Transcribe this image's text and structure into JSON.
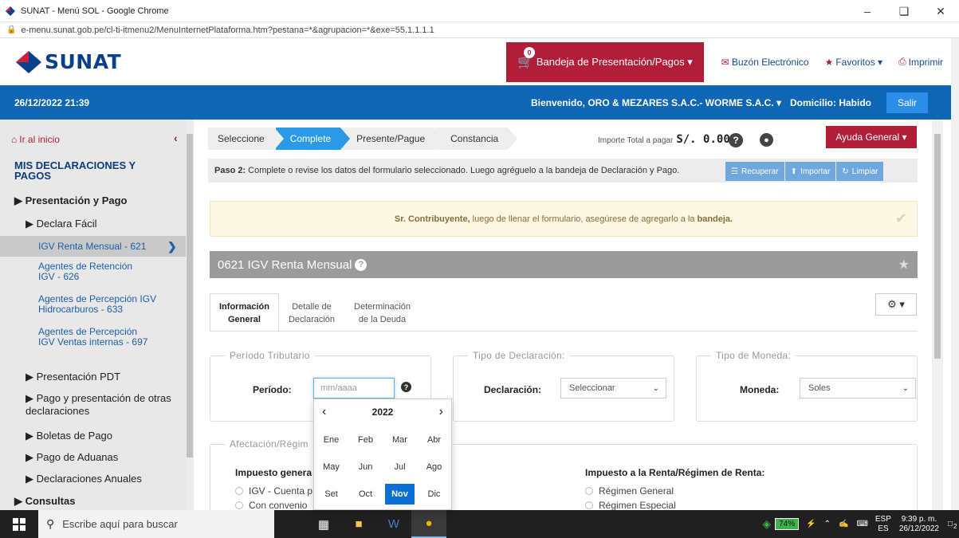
{
  "browser": {
    "window_title": "SUNAT - Menú SOL - Google Chrome",
    "url": "e-menu.sunat.gob.pe/cl-ti-itmenu2/MenuInternetPlataforma.htm?pestana=*&agrupacion=*&exe=55.1.1.1.1"
  },
  "header": {
    "logo_text": "SUNAT",
    "cart_count": "0",
    "bandeja_label": "Bandeja de Presentación/Pagos ▾",
    "buzon_label": "Buzón Electrónico",
    "favoritos_label": "Favoritos ▾",
    "imprimir_label": "Imprimir"
  },
  "bluebar": {
    "datetime": "26/12/2022 21:39",
    "welcome": "Bienvenido, ORO & MEZARES S.A.C.- WORME S.A.C. ▾",
    "domicilio": "Domicilio: Habido",
    "salir_label": "Salir"
  },
  "sidebar": {
    "home_label": "Ir al inicio",
    "title": "MIS DECLARACIONES Y PAGOS",
    "items": [
      {
        "label": "▶ Presentación y Pago"
      },
      {
        "label": "▶ Declara Fácil"
      },
      {
        "label": "IGV Renta Mensual - 621"
      },
      {
        "label": "Agentes de Retención IGV - 626"
      },
      {
        "label": "Agentes de Percepción IGV Hidrocarburos - 633"
      },
      {
        "label": "Agentes de Percepción IGV Ventas internas - 697"
      },
      {
        "label": "▶ Presentación PDT"
      },
      {
        "label": "▶ Pago y presentación de otras declaraciones"
      },
      {
        "label": "▶ Boletas de Pago"
      },
      {
        "label": "▶ Pago de Aduanas"
      },
      {
        "label": "▶ Declaraciones Anuales"
      },
      {
        "label": "▶ Consultas"
      }
    ]
  },
  "steps": [
    "Seleccione",
    "Complete",
    "Presente/Pague",
    "Constancia"
  ],
  "importe": {
    "label": "Importe Total a pagar",
    "amount": "S/. 0.00"
  },
  "ayuda_label": "Ayuda General ▾",
  "paso": {
    "step": "Paso 2:",
    "text": "Complete o revise los datos del formulario seleccionado. Luego agréguelo a la bandeja de Declaración y Pago.",
    "btn_recuperar": "Recuperar",
    "btn_importar": "Importar",
    "btn_limpiar": "Limpiar"
  },
  "alert": {
    "bold1": "Sr. Contribuyente,",
    "text": "luego de llenar el formulario, asegúrese de agregarlo a la",
    "bold2": "bandeja."
  },
  "form": {
    "title": "0621 IGV Renta Mensual",
    "tabs": [
      {
        "line1": "Información",
        "line2": "General"
      },
      {
        "line1": "Detalle de",
        "line2": "Declaración"
      },
      {
        "line1": "Determinación",
        "line2": "de la Deuda"
      }
    ],
    "periodo_legend": "Período Tributario",
    "periodo_label": "Período:",
    "periodo_placeholder": "mm/aaaa",
    "tipo_decl_legend": "Tipo de Declaración:",
    "declaracion_label": "Declaración:",
    "declaracion_value": "Seleccionar",
    "tipo_moneda_legend": "Tipo de Moneda:",
    "moneda_label": "Moneda:",
    "moneda_value": "Soles",
    "afectacion_legend": "Afectación/Régim",
    "impuesto_general_title": "Impuesto genera",
    "igv_options": [
      "IGV - Cuenta p",
      "Con convenio"
    ],
    "renta_title": "Impuesto a la Renta/Régimen de Renta:",
    "renta_options": [
      "Régimen General",
      "Régimen Especial"
    ]
  },
  "calendar": {
    "year": "2022",
    "months": [
      "Ene",
      "Feb",
      "Mar",
      "Abr",
      "May",
      "Jun",
      "Jul",
      "Ago",
      "Set",
      "Oct",
      "Nov",
      "Dic"
    ],
    "selected": "Nov"
  },
  "taskbar": {
    "search_placeholder": "Escribe aquí para buscar",
    "battery": "74%",
    "lang_top": "ESP",
    "lang_bottom": "ES",
    "time": "9:39 p. m.",
    "date": "26/12/2022",
    "notif_count": "2"
  }
}
